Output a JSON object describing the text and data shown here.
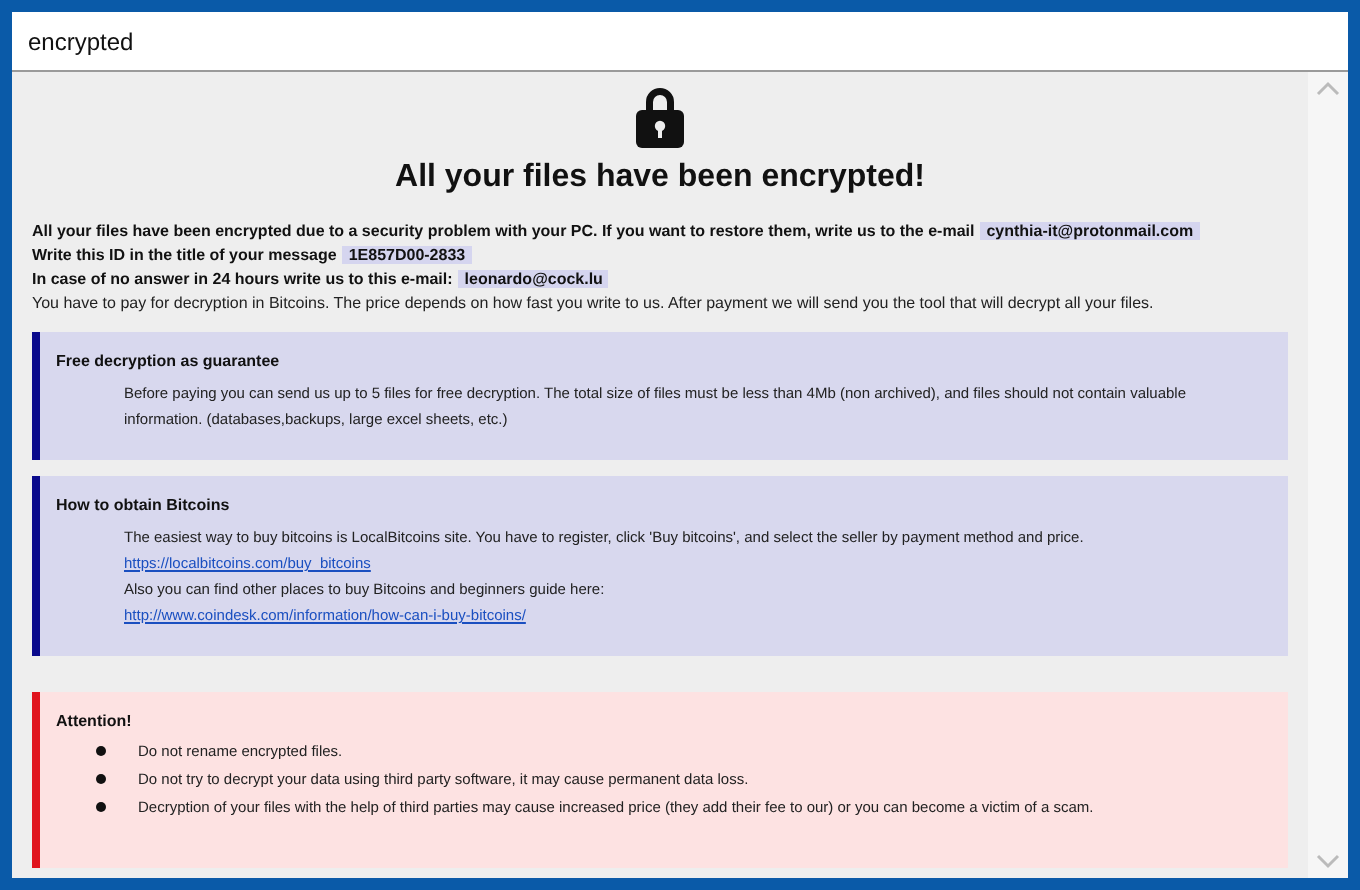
{
  "window": {
    "title": "encrypted"
  },
  "heading": "All your files have been encrypted!",
  "intro": [
    {
      "text": "All your files have been encrypted due to a security problem with your PC. If you want to restore them, write us to the e-mail",
      "highlight": "cynthia-it@protonmail.com",
      "bold": true
    },
    {
      "text": "Write this ID in the title of your message",
      "highlight": "1E857D00-2833",
      "bold": true
    },
    {
      "text": "In case of no answer in 24 hours write us to this e-mail:",
      "highlight": "leonardo@cock.lu",
      "bold": true
    },
    {
      "text": "You have to pay for decryption in Bitcoins. The price depends on how fast you write to us. After payment we will send you the tool that will decrypt all your files.",
      "bold": false
    }
  ],
  "sections": [
    {
      "kind": "info",
      "title": "Free decryption as guarantee",
      "items": [
        {
          "kind": "text",
          "text": "Before paying you can send us up to 5 files for free decryption. The total size of files must be less than 4Mb (non archived), and files should not contain valuable information. (databases,backups, large excel sheets, etc.)"
        }
      ]
    },
    {
      "kind": "info",
      "title": "How to obtain Bitcoins",
      "items": [
        {
          "kind": "text",
          "text": "The easiest way to buy bitcoins is LocalBitcoins site. You have to register, click 'Buy bitcoins', and select the seller by payment method and price."
        },
        {
          "kind": "link",
          "text": "https://localbitcoins.com/buy_bitcoins"
        },
        {
          "kind": "text",
          "text": "Also you can find other places to buy Bitcoins and beginners guide here:"
        },
        {
          "kind": "link",
          "text": "http://www.coindesk.com/information/how-can-i-buy-bitcoins/"
        }
      ]
    },
    {
      "kind": "warning",
      "title": "Attention!",
      "items": [
        {
          "kind": "bullet",
          "text": "Do not rename encrypted files."
        },
        {
          "kind": "bullet",
          "text": "Do not try to decrypt your data using third party software, it may cause permanent data loss."
        },
        {
          "kind": "bullet",
          "text": "Decryption of your files with the help of third parties may cause increased price (they add their fee to our) or you can become a victim of a scam."
        }
      ]
    }
  ]
}
